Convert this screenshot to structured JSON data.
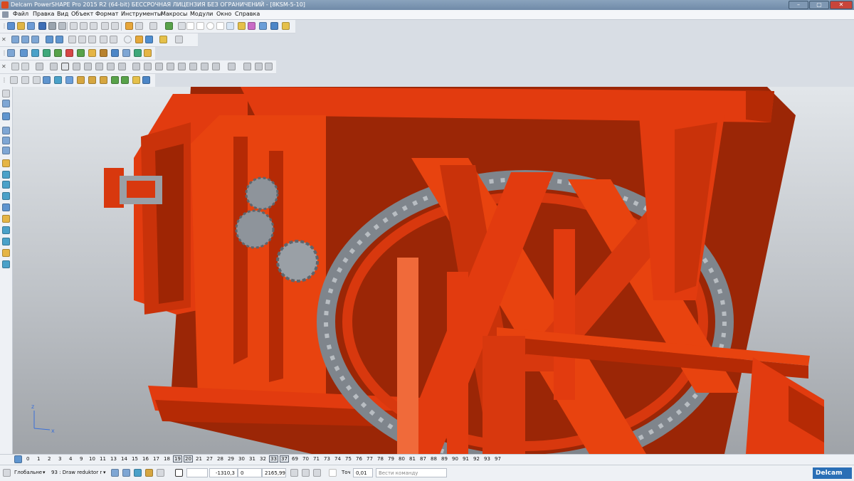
{
  "window": {
    "title": "Delcam PowerSHAPE Pro 2015 R2 (64-bit) БЕССРОЧНАЯ ЛИЦЕНЗИЯ БЕЗ ОГРАНИЧЕНИЙ - [8KSM-5-10]",
    "minimize": "–",
    "maximize": "▢",
    "close": "✕"
  },
  "menu": [
    "Файл",
    "Правка",
    "Вид",
    "Объект",
    "Формат",
    "Инструменты",
    "Макросы",
    "Модули",
    "Окно",
    "Справка"
  ],
  "viewport": {
    "axis_z": "z",
    "axis_x": "x",
    "colors": {
      "part_main": "#e23b0f",
      "part_dark": "#b52a05",
      "part_light": "#f05a2a",
      "gear": "#8e949b"
    }
  },
  "layers": [
    "0",
    "1",
    "2",
    "3",
    "4",
    "9",
    "10",
    "11",
    "13",
    "14",
    "15",
    "16",
    "17",
    "18",
    "19",
    "20",
    "21",
    "27",
    "28",
    "29",
    "30",
    "31",
    "32",
    "33",
    "37",
    "69",
    "70",
    "71",
    "73",
    "74",
    "75",
    "76",
    "77",
    "78",
    "79",
    "80",
    "81",
    "87",
    "88",
    "89",
    "90",
    "91",
    "92",
    "93",
    "97"
  ],
  "layers_active": [
    "19",
    "20",
    "33",
    "37"
  ],
  "status": {
    "workplane": "Глобальне",
    "level": "93 : Draw reduktor r",
    "x": "-1310,3",
    "y": "0",
    "z": "2165,99",
    "tolerance_label": "Точ",
    "tolerance": "0,01",
    "command_placeholder": "Вести команду",
    "brand": "Delcam"
  }
}
